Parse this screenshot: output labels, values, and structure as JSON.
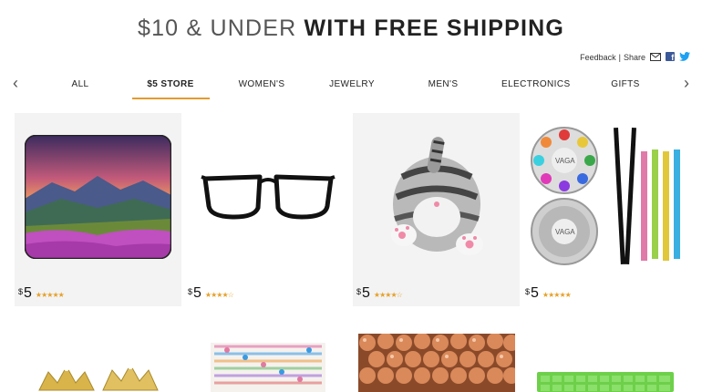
{
  "hero": {
    "light": "$10 & UNDER",
    "bold": "WITH FREE SHIPPING"
  },
  "meta": {
    "feedback": "Feedback",
    "separator": "|",
    "share": "Share"
  },
  "nav": {
    "tabs": [
      {
        "label": "ALL",
        "active": false
      },
      {
        "label": "$5 STORE",
        "active": true
      },
      {
        "label": "WOMEN'S",
        "active": false
      },
      {
        "label": "JEWELRY",
        "active": false
      },
      {
        "label": "MEN'S",
        "active": false
      },
      {
        "label": "ELECTRONICS",
        "active": false
      },
      {
        "label": "GIFTS",
        "active": false
      }
    ],
    "left_arrow": "‹",
    "right_arrow": "›",
    "accent_color": "#e49b2f"
  },
  "products": [
    {
      "currency": "$",
      "price": "5",
      "rating": 4.5,
      "stars": "★★★★★",
      "image": "mountain-mousepad"
    },
    {
      "currency": "$",
      "price": "5",
      "rating": 4.0,
      "stars": "★★★★☆",
      "image": "black-glasses"
    },
    {
      "currency": "$",
      "price": "5",
      "rating": 4.0,
      "stars": "★★★★☆",
      "image": "cat-plush"
    },
    {
      "currency": "$",
      "price": "5",
      "rating": 4.5,
      "stars": "★★★★★",
      "image": "nail-art-kit"
    },
    {
      "image": "gold-tiaras"
    },
    {
      "image": "floral-hankies"
    },
    {
      "image": "copper-beads"
    },
    {
      "image": "green-keyboard-cover"
    }
  ],
  "colors": {
    "star": "#e6a129",
    "card_bg": "#f3f3f3",
    "facebook": "#3b5998",
    "twitter": "#1da1f2"
  }
}
